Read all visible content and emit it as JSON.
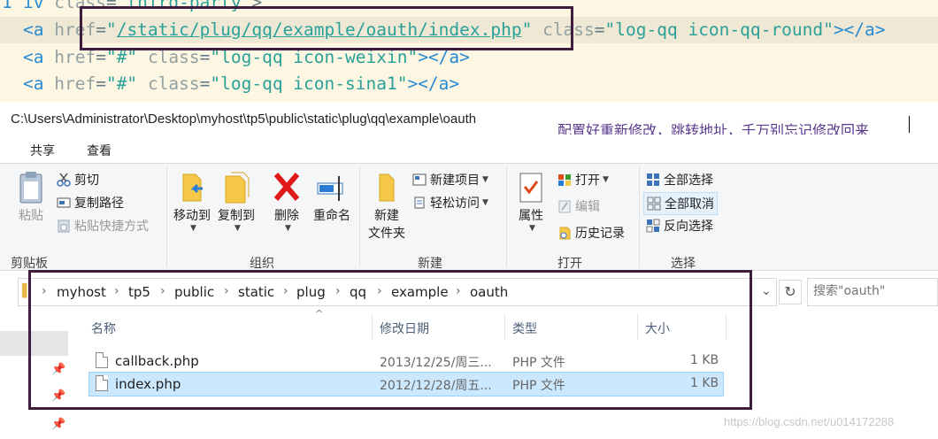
{
  "code": {
    "line0": {
      "kw": "iv",
      "attr": "class",
      "op": "=",
      "str": "\"third-party\"",
      "end": ">"
    },
    "line1": {
      "open": "<a",
      "href_attr": "href",
      "eq": "=",
      "href_val": "\"",
      "href_path": "/static/plug/qq/example/oauth/index.php",
      "href_close": "\"",
      "class_attr": "class",
      "class_val": "\"log-qq icon-qq-round\"",
      "end": "></a>"
    },
    "line2": {
      "open": "<a",
      "href_attr": "href",
      "eq": "=",
      "href_val": "\"#\"",
      "class_attr": "class",
      "class_val": "\"log-qq icon-weixin\"",
      "end": "></a>"
    },
    "line3": {
      "open": "<a",
      "href_attr": "href",
      "eq": "=",
      "href_val": "\"#\"",
      "class_attr": "class",
      "class_val": "\"log-qq icon-sina1\"",
      "end": "></a>"
    },
    "gutter": "1"
  },
  "window": {
    "path": "C:\\Users\\Administrator\\Desktop\\myhost\\tp5\\public\\static\\plug\\qq\\example\\oauth",
    "note": "配置好重新修改，跳转地址，千万别忘记修改回来"
  },
  "ribbon_tabs": [
    "共享",
    "查看"
  ],
  "ribbon": {
    "clipboard": {
      "paste": "粘贴",
      "cut": "剪切",
      "copy_path": "复制路径",
      "paste_shortcut": "粘贴快捷方式",
      "label": "剪贴板"
    },
    "organize": {
      "move_to": "移动到",
      "copy_to": "复制到",
      "delete": "删除",
      "rename": "重命名",
      "label": "组织"
    },
    "new": {
      "new_folder_1": "新建",
      "new_folder_2": "文件夹",
      "new_item": "新建项目",
      "easy_access": "轻松访问",
      "label": "新建"
    },
    "open": {
      "properties": "属性",
      "open": "打开",
      "edit": "编辑",
      "history": "历史记录",
      "label": "打开"
    },
    "select": {
      "select_all": "全部选择",
      "select_none": "全部取消",
      "invert": "反向选择",
      "label": "选择"
    }
  },
  "address": {
    "crumbs": [
      "myhost",
      "tp5",
      "public",
      "static",
      "plug",
      "qq",
      "example",
      "oauth"
    ],
    "search_placeholder": "搜索\"oauth\""
  },
  "columns": {
    "name": "名称",
    "date": "修改日期",
    "type": "类型",
    "size": "大小"
  },
  "files": [
    {
      "name": "callback.php",
      "date": "2013/12/25/周三...",
      "type": "PHP 文件",
      "size": "1 KB"
    },
    {
      "name": "index.php",
      "date": "2012/12/28/周五...",
      "type": "PHP 文件",
      "size": "1 KB"
    }
  ],
  "watermark": "https://blog.csdn.net/u014172288",
  "colors": {
    "code_bg": "#fdf6e3",
    "selection": "#cce8ff",
    "annotation": "#3d1c3e",
    "string": "#2aa198",
    "keyword": "#268bd2"
  }
}
